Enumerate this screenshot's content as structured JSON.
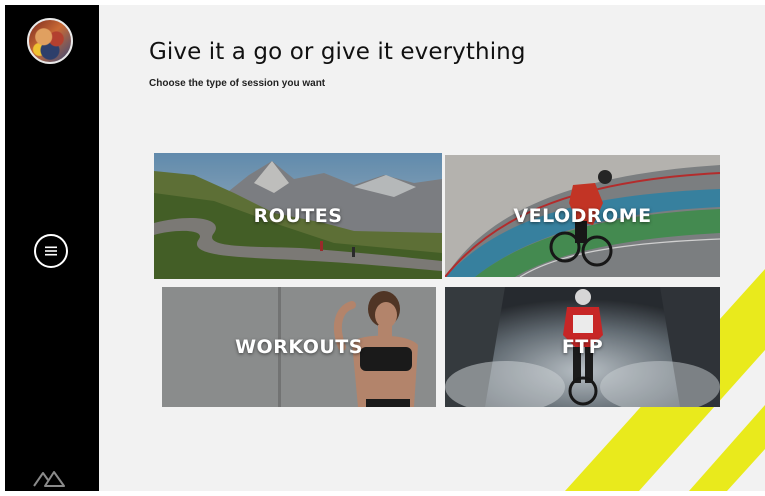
{
  "page": {
    "title": "Give it a go or give it everything",
    "subtitle": "Choose the type of session you want"
  },
  "sidebar": {
    "avatar_icon": "profile-avatar",
    "menu_icon": "menu-icon",
    "logo_icon": "brand-logo-icon"
  },
  "sessions": [
    {
      "label": "ROUTES"
    },
    {
      "label": "VELODROME"
    },
    {
      "label": "WORKOUTS"
    },
    {
      "label": "FTP"
    }
  ],
  "colors": {
    "sidebar": "#000000",
    "background": "#f2f2f2",
    "accent_stripe": "#e9ea1c",
    "label": "#ffffff"
  }
}
